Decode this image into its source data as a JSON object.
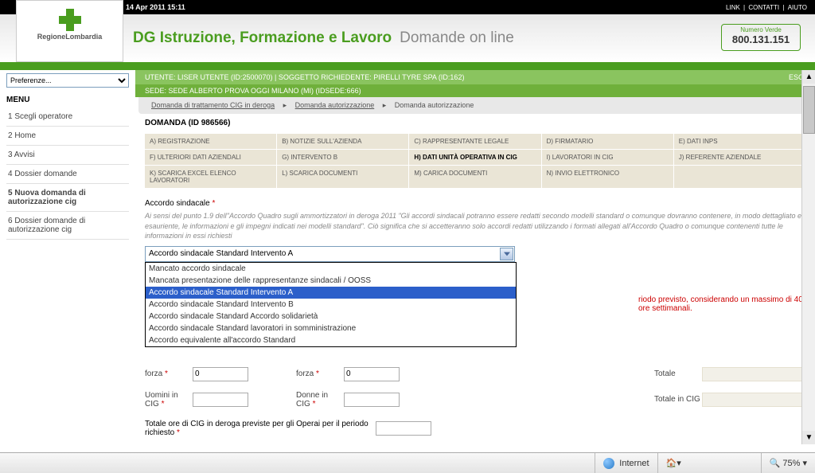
{
  "topbar": {
    "datetime": "14 Apr 2011 15:11",
    "links": [
      "LINK",
      "CONTATTI",
      "AIUTO"
    ]
  },
  "logo_text": "RegioneLombardia",
  "header": {
    "title_green": "DG Istruzione, Formazione e Lavoro",
    "title_grey": "Domande on line",
    "phone_label": "Numero Verde",
    "phone_number": "800.131.151"
  },
  "sidebar": {
    "pref_placeholder": "Preferenze...",
    "menu_title": "MENU",
    "items": [
      "1  Scegli operatore",
      "2  Home",
      "3  Avvisi",
      "4  Dossier domande",
      "5  Nuova domanda di autorizzazione cig",
      "6  Dossier domande di autorizzazione cig"
    ],
    "active_index": 4
  },
  "userbar": {
    "text": "UTENTE:  LISER UTENTE (ID:2500070)  |  SOGGETTO RICHIEDENTE:  PIRELLI TYRE SPA (ID:162)",
    "esci": "ESCI"
  },
  "sedebar": {
    "text": "SEDE:  SEDE ALBERTO PROVA OGGI MILANO (MI) (IDSEDE:666)"
  },
  "breadcrumb": {
    "a": "Domanda di trattamento CIG in deroga",
    "b": "Domanda autorizzazione",
    "c": "Domanda autorizzazione"
  },
  "content_title": "DOMANDA (ID 986566)",
  "tabs": [
    "A) REGISTRAZIONE",
    "B) NOTIZIE SULL'AZIENDA",
    "C) RAPPRESENTANTE LEGALE",
    "D) FIRMATARIO",
    "E) DATI INPS",
    "F) ULTERIORI DATI AZIENDALI",
    "G) INTERVENTO B",
    "H) DATI UNITÀ OPERATIVA IN CIG",
    "I) LAVORATORI IN CIG",
    "J) REFERENTE AZIENDALE",
    "K) SCARICA EXCEL ELENCO LAVORATORI",
    "L) SCARICA DOCUMENTI",
    "M) CARICA DOCUMENTI",
    "N) INVIO ELETTRONICO",
    ""
  ],
  "tabs_active_index": 7,
  "accordo": {
    "label": "Accordo sindacale",
    "helptext": "Ai sensi del punto 1.9 dell''Accordo Quadro sugli ammortizzatori in deroga 2011 \"Gli accordi sindacali potranno essere redatti secondo modelli standard o comunque dovranno contenere, in modo dettagliato ed esauriente, le informazioni e gli impegni indicati nei modelli standard\". Ciò significa che si accetteranno solo accordi redatti utilizzando i formati allegati all'Accordo Quadro o comunque contenenti tutte le informazioni in essi richiesti",
    "selected": "Accordo sindacale Standard Intervento A",
    "options": [
      "Mancato accordo sindacale",
      "Mancata presentazione delle rappresentanze sindacali / OOSS",
      "Accordo sindacale Standard Intervento A",
      "Accordo sindacale Standard Intervento B",
      "Accordo sindacale Standard Accordo solidarietà",
      "Accordo sindacale Standard lavoratori in somministrazione",
      "Accordo equivalente all'accordo Standard"
    ],
    "selected_index": 2
  },
  "red_hint": "riodo previsto, considerando un massimo di 40 ore settimanali.",
  "form": {
    "forza_m_label": "forza",
    "forza_m_val": "0",
    "forza_f_label": "forza",
    "forza_f_val": "0",
    "totale_label": "Totale",
    "uomini_label": "Uomini in CIG",
    "donne_label": "Donne in CIG",
    "totale_cig_label": "Totale in CIG",
    "totale_ore_label": "Totale ore di CIG in deroga previste per gli Operai per il periodo richiesto"
  },
  "statusbar": {
    "internet": "Internet",
    "zoom": "75%"
  }
}
